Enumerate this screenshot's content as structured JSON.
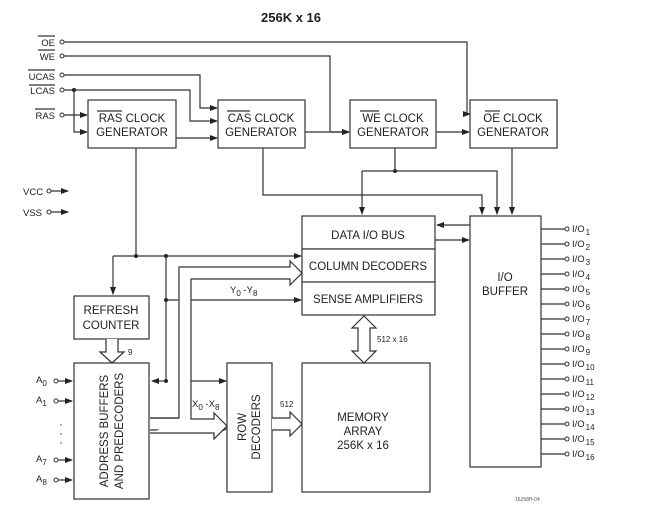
{
  "title": "256K x 16",
  "figure_id": "16258H-04",
  "control_inputs": {
    "oe": "OE",
    "we": "WE",
    "ucas": "UCAS",
    "lcas": "LCAS",
    "ras": "RAS"
  },
  "power_inputs": {
    "vcc": "VCC",
    "vss": "VSS"
  },
  "blocks": {
    "ras_clock": {
      "line1_bar": "RAS",
      "line1_rest": " CLOCK",
      "line2": "GENERATOR"
    },
    "cas_clock": {
      "line1_bar": "CAS",
      "line1_rest": " CLOCK",
      "line2": "GENERATOR"
    },
    "we_clock": {
      "line1_bar": "WE",
      "line1_rest": " CLOCK",
      "line2": "GENERATOR"
    },
    "oe_clock": {
      "line1_bar": "OE",
      "line1_rest": " CLOCK",
      "line2": "GENERATOR"
    },
    "data_io_bus": "DATA I/O BUS",
    "column_decoders": "COLUMN DECODERS",
    "sense_amplifiers": "SENSE AMPLIFIERS",
    "refresh_counter": {
      "line1": "REFRESH",
      "line2": "COUNTER"
    },
    "address_buffers": {
      "line1": "ADDRESS BUFFERS",
      "line2": "AND PREDECODERS"
    },
    "row_decoders": {
      "line1": "ROW",
      "line2": "DECODERS"
    },
    "memory_array": {
      "line1": "MEMORY",
      "line2": "ARRAY",
      "line3": "256K x 16"
    },
    "io_buffer": {
      "line1": "I/O",
      "line2": "BUFFER"
    }
  },
  "bus_labels": {
    "refresh_width": "9",
    "array_width": "512 x 16",
    "row_width": "512",
    "y_range": {
      "a": "Y",
      "a_sub": "0",
      "sep": " -Y",
      "b_sub": "8"
    },
    "x_range": {
      "a": "X",
      "a_sub": "0",
      "sep": " -X",
      "b_sub": "8"
    }
  },
  "address_pins": [
    {
      "name": "A",
      "sub": "0"
    },
    {
      "name": "A",
      "sub": "1"
    },
    {
      "name": "A",
      "sub": "7"
    },
    {
      "name": "A",
      "sub": "8"
    }
  ],
  "address_ellipsis": "·",
  "io_pins": [
    {
      "name": "I/O",
      "sub": "1"
    },
    {
      "name": "I/O",
      "sub": "2"
    },
    {
      "name": "I/O",
      "sub": "3"
    },
    {
      "name": "I/O",
      "sub": "4"
    },
    {
      "name": "I/O",
      "sub": "5"
    },
    {
      "name": "I/O",
      "sub": "6"
    },
    {
      "name": "I/O",
      "sub": "7"
    },
    {
      "name": "I/O",
      "sub": "8"
    },
    {
      "name": "I/O",
      "sub": "9"
    },
    {
      "name": "I/O",
      "sub": "10"
    },
    {
      "name": "I/O",
      "sub": "11"
    },
    {
      "name": "I/O",
      "sub": "12"
    },
    {
      "name": "I/O",
      "sub": "13"
    },
    {
      "name": "I/O",
      "sub": "14"
    },
    {
      "name": "I/O",
      "sub": "15"
    },
    {
      "name": "I/O",
      "sub": "16"
    }
  ]
}
